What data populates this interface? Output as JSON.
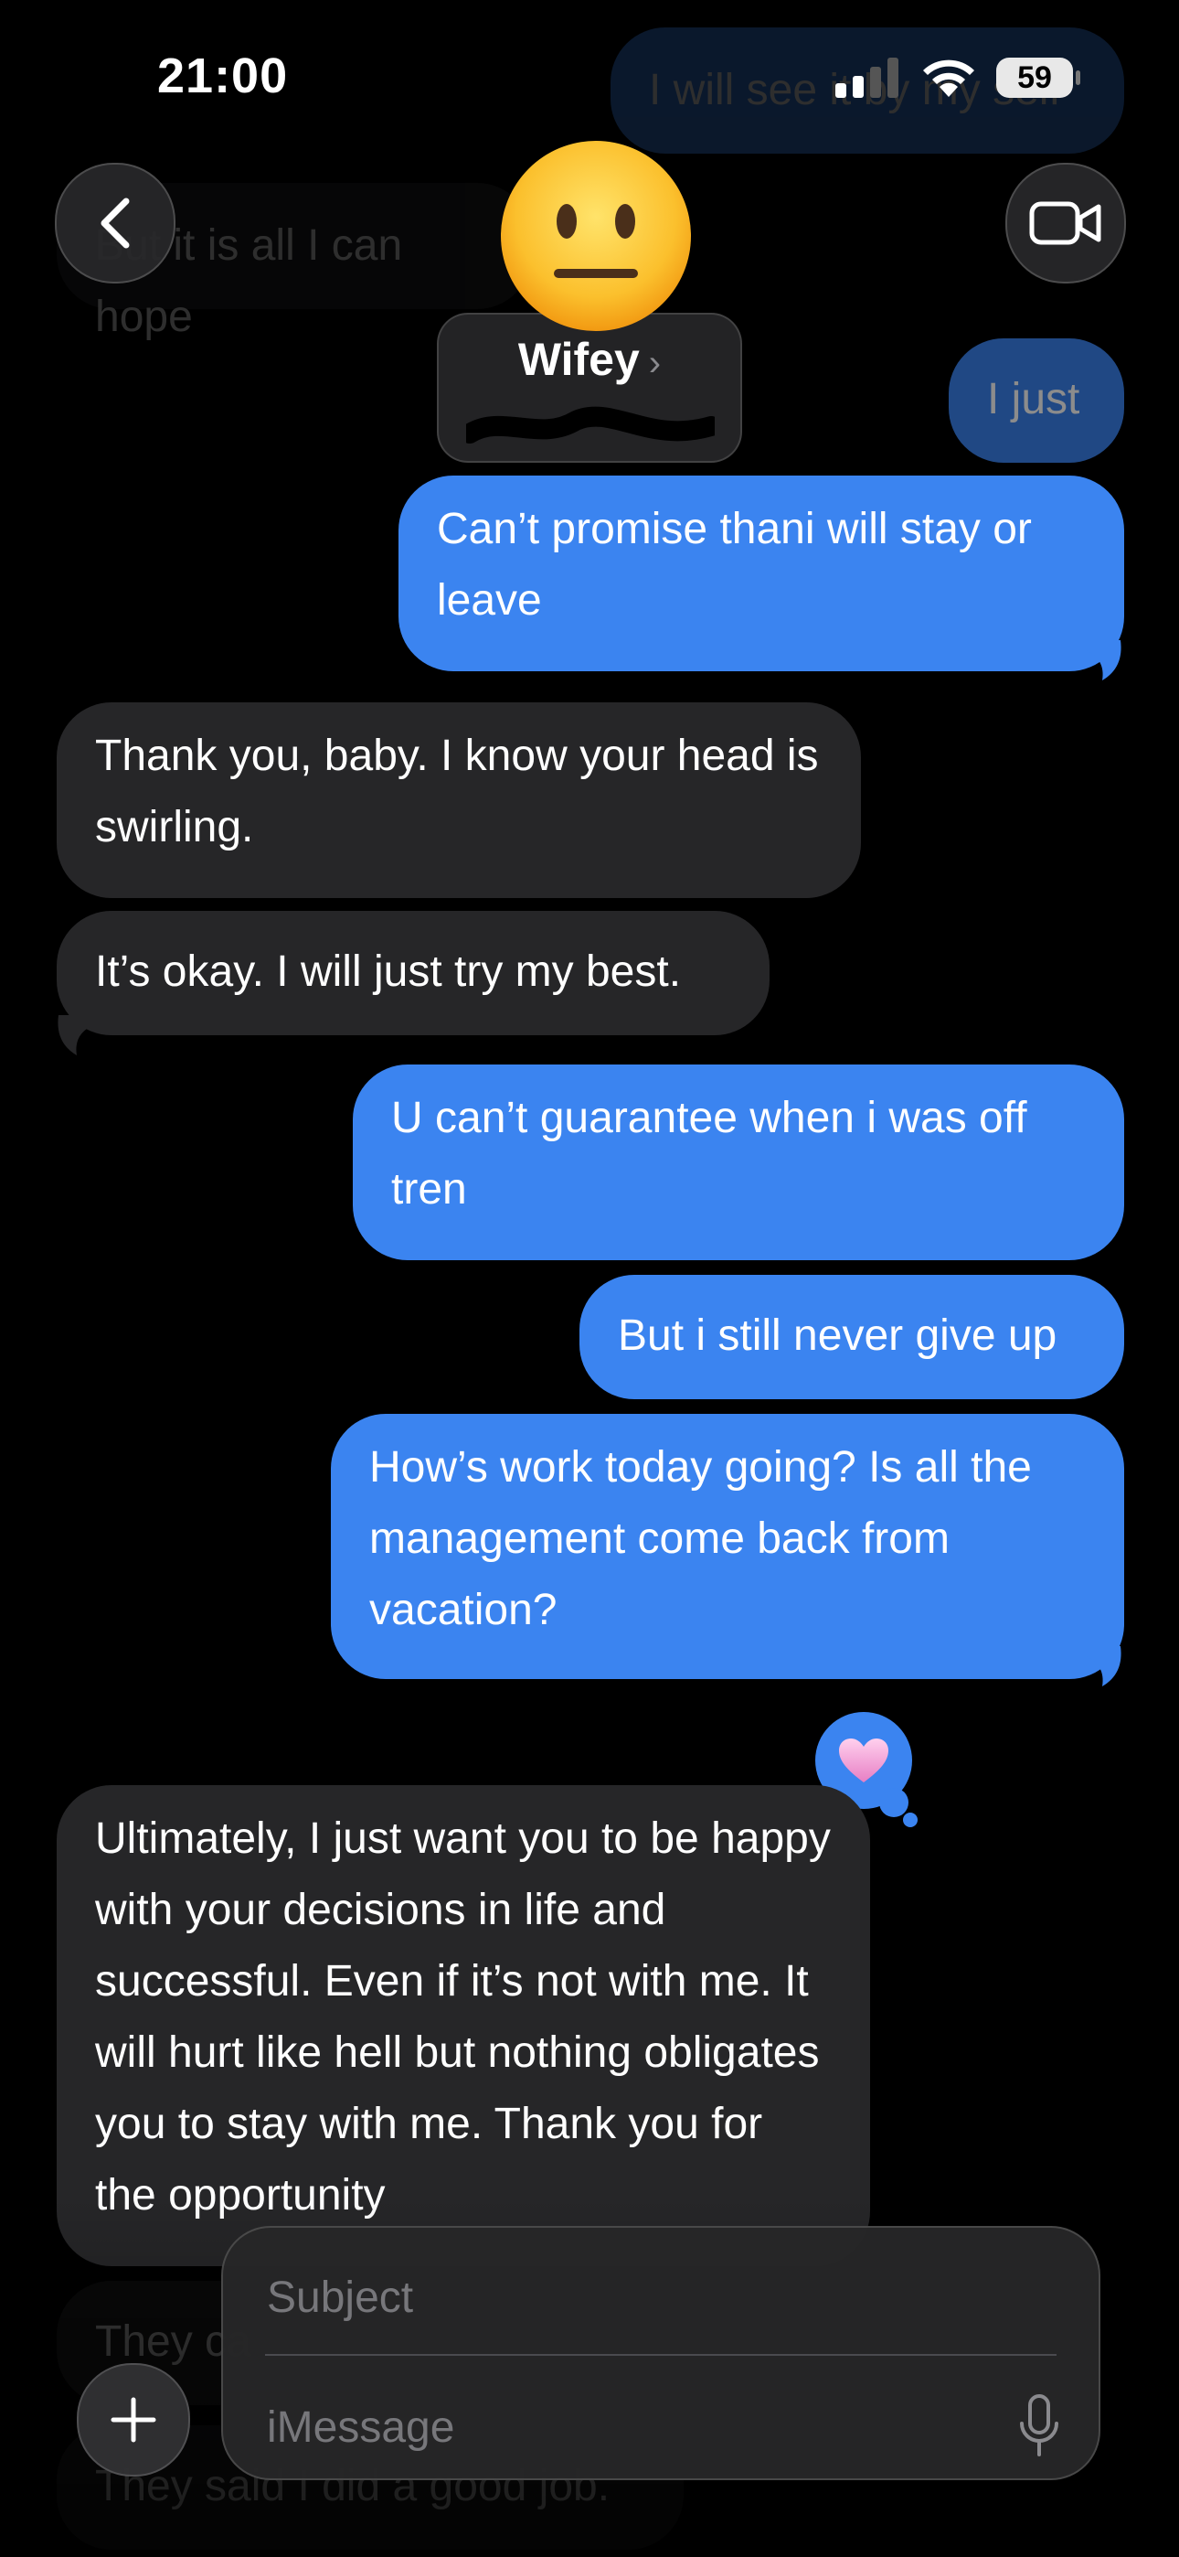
{
  "status_bar": {
    "time": "21:00",
    "battery": "59"
  },
  "header": {
    "contact_name": "Wifey"
  },
  "messages": [
    {
      "text": "I will see it by my self"
    },
    {
      "text": "But it is all I can hope"
    },
    {
      "text": "I just"
    },
    {
      "text": "Can’t promise thani will stay or leave"
    },
    {
      "text": "Thank you, baby. I know your head is swirling."
    },
    {
      "text": "It’s okay. I will just try my best."
    },
    {
      "text": "U can’t guarantee when i was off tren"
    },
    {
      "text": "But i still never give up"
    },
    {
      "text": "How’s work today going? Is all the management come back from vacation?"
    },
    {
      "text": "Ultimately, I just want you to be happy with your decisions in life and successful. Even if it’s not with me. It will hurt like hell but nothing obligates you to stay with me. Thank you for the opportunity"
    },
    {
      "text": "They ca"
    },
    {
      "text": "They said I did a good job."
    }
  ],
  "reaction": {
    "icon": "heart-icon",
    "color": "#f4a6d7"
  },
  "compose": {
    "subject_placeholder": "Subject",
    "message_placeholder": "iMessage"
  },
  "colors": {
    "outgoing": "#3b84f0",
    "incoming": "#262628",
    "background": "#000000"
  }
}
